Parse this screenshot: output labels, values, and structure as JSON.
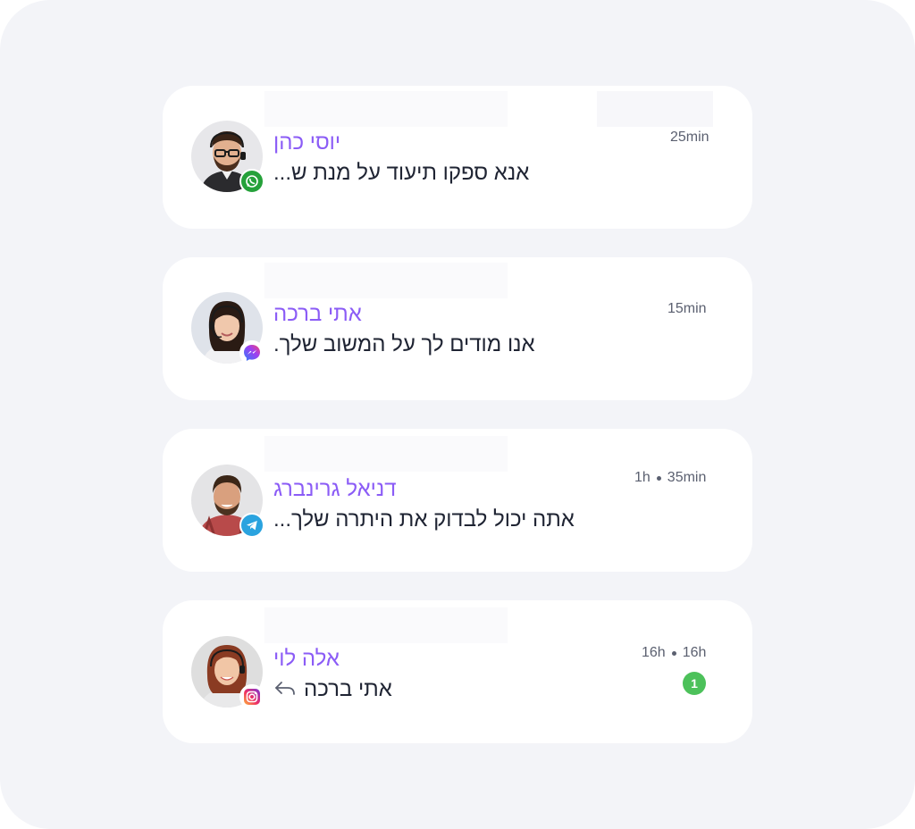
{
  "conversations": [
    {
      "name": "יוסי כהן",
      "message": "אנא ספקו תיעוד על מנת ש...",
      "time": "25min",
      "channel": "whatsapp-icon",
      "channel_color": "#25a13a"
    },
    {
      "name": "אתי ברכה",
      "message": "אנו מודים לך על המשוב שלך.",
      "time": "15min",
      "channel": "messenger-icon",
      "channel_color": "#8b5cf6"
    },
    {
      "name": "דניאל גרינברג",
      "message": "אתה יכול לבדוק את היתרה שלך...",
      "time_parts": [
        "1h",
        "35min"
      ],
      "channel": "telegram-icon",
      "channel_color": "#2aa3df"
    },
    {
      "name": "אלה לוי",
      "message": "אתי ברכה",
      "time_parts": [
        "16h",
        "16h"
      ],
      "unread_count": "1",
      "reply_icon": "reply-arrow-icon",
      "channel": "instagram-icon",
      "channel_color": "#e1306c"
    }
  ]
}
